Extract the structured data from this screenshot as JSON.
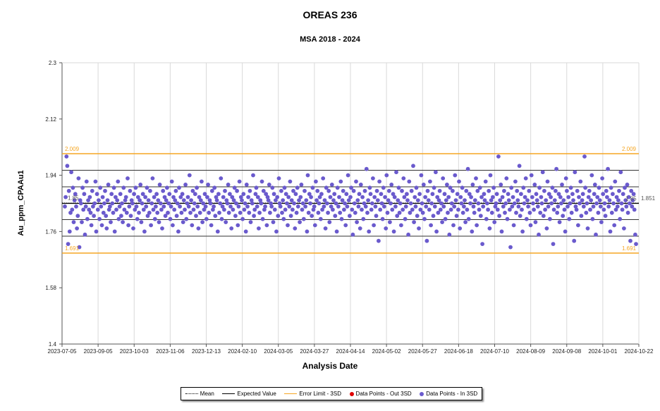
{
  "chart_data": {
    "type": "scatter",
    "title": "OREAS 236",
    "subtitle": "MSA 2018 - 2024",
    "xlabel": "Analysis Date",
    "ylabel": "Au_ppm_CPAAu1",
    "x_tick_labels": [
      "2023-07-05",
      "2023-09-05",
      "2023-10-03",
      "2023-11-06",
      "2023-12-13",
      "2024-02-10",
      "2024-03-05",
      "2024-03-27",
      "2024-04-14",
      "2024-05-02",
      "2024-05-27",
      "2024-06-18",
      "2024-07-10",
      "2024-08-09",
      "2024-09-08",
      "2024-10-01",
      "2024-10-22"
    ],
    "y_ticks": [
      1.4,
      1.58,
      1.76,
      1.94,
      2.12,
      2.3
    ],
    "ylim": [
      1.4,
      2.3
    ],
    "mean": 1.851,
    "expected_value": 1.85,
    "sd_lines": [
      1.745,
      1.798,
      1.903,
      1.956
    ],
    "error_limit_upper": 2.009,
    "error_limit_lower": 1.691,
    "upper_label": "2.009",
    "lower_label": "1.691",
    "mean_label": "1.851",
    "expected_label": "1.85",
    "left_expected_label": "1.85",
    "grid": true,
    "series": [
      {
        "name": "Data Points - Out 3SD",
        "values": []
      },
      {
        "name": "Data Points - In 3SD",
        "values": [
          1.84,
          1.87,
          2.0,
          1.97,
          1.72,
          1.89,
          1.76,
          1.82,
          1.95,
          1.83,
          1.9,
          1.79,
          1.86,
          1.88,
          1.84,
          1.77,
          1.81,
          1.93,
          1.71,
          1.86,
          1.85,
          1.79,
          1.9,
          1.83,
          1.88,
          1.75,
          1.84,
          1.92,
          1.8,
          1.86,
          1.83,
          1.87,
          1.82,
          1.78,
          1.89,
          1.84,
          1.81,
          1.85,
          1.92,
          1.76,
          1.88,
          1.83,
          1.86,
          1.8,
          1.9,
          1.84,
          1.78,
          1.87,
          1.82,
          1.85,
          1.89,
          1.81,
          1.77,
          1.86,
          1.91,
          1.83,
          1.84,
          1.79,
          1.88,
          1.85,
          1.82,
          1.9,
          1.76,
          1.87,
          1.83,
          1.86,
          1.92,
          1.8,
          1.84,
          1.88,
          1.81,
          1.85,
          1.79,
          1.9,
          1.83,
          1.86,
          1.87,
          1.82,
          1.93,
          1.78,
          1.84,
          1.89,
          1.81,
          1.86,
          1.85,
          1.77,
          1.88,
          1.83,
          1.9,
          1.84,
          1.8,
          1.87,
          1.82,
          1.86,
          1.91,
          1.79,
          1.85,
          1.88,
          1.83,
          1.76,
          1.87,
          1.84,
          1.9,
          1.81,
          1.86,
          1.82,
          1.89,
          1.78,
          1.85,
          1.93,
          1.83,
          1.87,
          1.8,
          1.84,
          1.88,
          1.82,
          1.86,
          1.79,
          1.91,
          1.85,
          1.83,
          1.77,
          1.89,
          1.84,
          1.87,
          1.81,
          1.86,
          1.9,
          1.82,
          1.85,
          1.88,
          1.8,
          1.84,
          1.92,
          1.78,
          1.87,
          1.83,
          1.86,
          1.89,
          1.81,
          1.85,
          1.76,
          1.9,
          1.84,
          1.87,
          1.82,
          1.88,
          1.79,
          1.86,
          1.83,
          1.91,
          1.8,
          1.85,
          1.87,
          1.84,
          1.94,
          1.82,
          1.86,
          1.78,
          1.89,
          1.83,
          1.85,
          1.88,
          1.81,
          1.9,
          1.84,
          1.77,
          1.87,
          1.82,
          1.86,
          1.92,
          1.79,
          1.85,
          1.83,
          1.88,
          1.84,
          1.8,
          1.87,
          1.91,
          1.82,
          1.86,
          1.85,
          1.78,
          1.89,
          1.83,
          1.84,
          1.9,
          1.81,
          1.87,
          1.86,
          1.76,
          1.88,
          1.82,
          1.85,
          1.93,
          1.8,
          1.84,
          1.87,
          1.83,
          1.89,
          1.79,
          1.86,
          1.85,
          1.91,
          1.82,
          1.88,
          1.84,
          1.77,
          1.87,
          1.83,
          1.86,
          1.9,
          1.81,
          1.85,
          1.89,
          1.78,
          1.84,
          1.92,
          1.82,
          1.87,
          1.86,
          1.8,
          1.88,
          1.83,
          1.85,
          1.76,
          1.91,
          1.84,
          1.87,
          1.82,
          1.89,
          1.79,
          1.86,
          1.85,
          1.94,
          1.81,
          1.83,
          1.88,
          1.9,
          1.84,
          1.87,
          1.77,
          1.82,
          1.86,
          1.85,
          1.92,
          1.8,
          1.89,
          1.83,
          1.84,
          1.88,
          1.78,
          1.87,
          1.86,
          1.91,
          1.82,
          1.85,
          1.84,
          1.9,
          1.79,
          1.88,
          1.83,
          1.86,
          1.76,
          1.87,
          1.81,
          1.93,
          1.85,
          1.84,
          1.89,
          1.82,
          1.86,
          1.8,
          1.9,
          1.83,
          1.88,
          1.85,
          1.78,
          1.87,
          1.84,
          1.92,
          1.81,
          1.86,
          1.83,
          1.89,
          1.85,
          1.77,
          1.88,
          1.82,
          1.9,
          1.84,
          1.86,
          1.79,
          1.87,
          1.91,
          1.83,
          1.85,
          1.8,
          1.89,
          1.84,
          1.86,
          1.76,
          1.94,
          1.82,
          1.88,
          1.85,
          1.87,
          1.81,
          1.9,
          1.83,
          1.84,
          1.78,
          1.92,
          1.86,
          1.89,
          1.82,
          1.85,
          1.87,
          1.8,
          1.88,
          1.83,
          1.93,
          1.84,
          1.86,
          1.77,
          1.9,
          1.85,
          1.82,
          1.89,
          1.79,
          1.87,
          1.84,
          1.91,
          1.83,
          1.86,
          1.88,
          1.81,
          1.85,
          1.76,
          1.9,
          1.84,
          1.87,
          1.82,
          1.92,
          1.8,
          1.86,
          1.89,
          1.83,
          1.85,
          1.78,
          1.88,
          1.84,
          1.94,
          1.86,
          1.81,
          1.87,
          1.9,
          1.83,
          1.75,
          1.89,
          1.85,
          1.82,
          1.92,
          1.79,
          1.86,
          1.84,
          1.88,
          1.77,
          1.91,
          1.83,
          1.87,
          1.8,
          1.85,
          1.89,
          1.84,
          1.96,
          1.82,
          1.86,
          1.76,
          1.9,
          1.88,
          1.83,
          1.85,
          1.93,
          1.78,
          1.87,
          1.84,
          1.81,
          1.89,
          1.86,
          1.73,
          1.92,
          1.83,
          1.88,
          1.85,
          1.8,
          1.9,
          1.84,
          1.87,
          1.77,
          1.94,
          1.82,
          1.86,
          1.89,
          1.79,
          1.85,
          1.91,
          1.83,
          1.88,
          1.76,
          1.87,
          1.84,
          1.95,
          1.81,
          1.86,
          1.9,
          1.82,
          1.85,
          1.78,
          1.89,
          1.83,
          1.93,
          1.87,
          1.8,
          1.84,
          1.88,
          1.86,
          1.75,
          1.92,
          1.82,
          1.85,
          1.89,
          1.83,
          1.97,
          1.79,
          1.87,
          1.84,
          1.9,
          1.81,
          1.86,
          1.77,
          1.88,
          1.83,
          1.94,
          1.85,
          1.82,
          1.91,
          1.8,
          1.87,
          1.84,
          1.73,
          1.89,
          1.86,
          1.83,
          1.92,
          1.78,
          1.85,
          1.88,
          1.81,
          1.9,
          1.84,
          1.95,
          1.76,
          1.87,
          1.82,
          1.86,
          1.89,
          1.83,
          1.85,
          1.79,
          1.93,
          1.84,
          1.88,
          1.8,
          1.86,
          1.91,
          1.82,
          1.87,
          1.75,
          1.9,
          1.83,
          1.85,
          1.89,
          1.78,
          1.84,
          1.94,
          1.86,
          1.81,
          1.88,
          1.83,
          1.92,
          1.77,
          1.87,
          1.85,
          1.9,
          1.82,
          1.84,
          1.86,
          1.79,
          1.89,
          1.83,
          1.96,
          1.8,
          1.88,
          1.85,
          1.87,
          1.76,
          1.91,
          1.84,
          1.82,
          1.86,
          1.93,
          1.78,
          1.89,
          1.85,
          1.83,
          1.9,
          1.81,
          1.87,
          1.72,
          1.84,
          1.88,
          1.86,
          1.92,
          1.8,
          1.85,
          1.83,
          1.89,
          1.77,
          1.94,
          1.86,
          1.82,
          1.87,
          1.9,
          1.79,
          1.84,
          1.85,
          1.88,
          1.83,
          2.0,
          1.81,
          1.86,
          1.91,
          1.76,
          1.87,
          1.84,
          1.89,
          1.82,
          1.85,
          1.93,
          1.8,
          1.88,
          1.86,
          1.83,
          1.71,
          1.9,
          1.84,
          1.87,
          1.78,
          1.85,
          1.92,
          1.82,
          1.89,
          1.86,
          1.84,
          1.97,
          1.81,
          1.88,
          1.83,
          1.76,
          1.9,
          1.85,
          1.87,
          1.93,
          1.8,
          1.86,
          1.84,
          1.89,
          1.82,
          1.78,
          1.94,
          1.87,
          1.85,
          1.83,
          1.91,
          1.79,
          1.88,
          1.86,
          1.84,
          1.75,
          1.9,
          1.82,
          1.87,
          1.85,
          1.95,
          1.81,
          1.89,
          1.83,
          1.86,
          1.77,
          1.92,
          1.84,
          1.88,
          1.8,
          1.87,
          1.85,
          1.9,
          1.72,
          1.83,
          1.86,
          1.89,
          1.96,
          1.82,
          1.84,
          1.88,
          1.79,
          1.87,
          1.85,
          1.91,
          1.81,
          1.86,
          1.83,
          1.76,
          1.93,
          1.89,
          1.84,
          1.87,
          1.8,
          1.85,
          1.9,
          1.82,
          1.88,
          1.86,
          1.73,
          1.95,
          1.84,
          1.83,
          1.89,
          1.78,
          1.87,
          1.85,
          1.92,
          1.81,
          1.86,
          1.88,
          1.84,
          2.0,
          1.9,
          1.82,
          1.85,
          1.77,
          1.87,
          1.89,
          1.83,
          1.86,
          1.94,
          1.8,
          1.84,
          1.88,
          1.91,
          1.75,
          1.85,
          1.87,
          1.82,
          1.9,
          1.86,
          1.84,
          1.79,
          1.93,
          1.88,
          1.83,
          1.85,
          1.81,
          1.89,
          1.87,
          1.96,
          1.84,
          1.86,
          1.76,
          1.9,
          1.82,
          1.88,
          1.85,
          1.78,
          1.92,
          1.83,
          1.87,
          1.84,
          1.86,
          1.89,
          1.8,
          1.95,
          1.85,
          1.83,
          1.88,
          1.77,
          1.9,
          1.86,
          1.84,
          1.91,
          1.82,
          1.87,
          1.85,
          1.73,
          1.89,
          1.84,
          1.86,
          1.88,
          1.83,
          1.75,
          1.72
        ]
      }
    ]
  },
  "legend": {
    "items": [
      {
        "label": "Mean",
        "style": "dotted",
        "color": "#000000"
      },
      {
        "label": "Expected Value",
        "style": "solid",
        "color": "#000000"
      },
      {
        "label": "Error Limit - 3SD",
        "style": "solid",
        "color": "#f5a623"
      },
      {
        "label": "Data Points - Out 3SD",
        "style": "dot",
        "color": "#e00000"
      },
      {
        "label": "Data Points - In 3SD",
        "style": "dot",
        "color": "#6a5acd"
      }
    ]
  },
  "colors": {
    "points_in": "#6a5acd",
    "points_out": "#e00000",
    "error_limit": "#f5a623",
    "grid": "#d9d9d9",
    "axis": "#555555"
  }
}
